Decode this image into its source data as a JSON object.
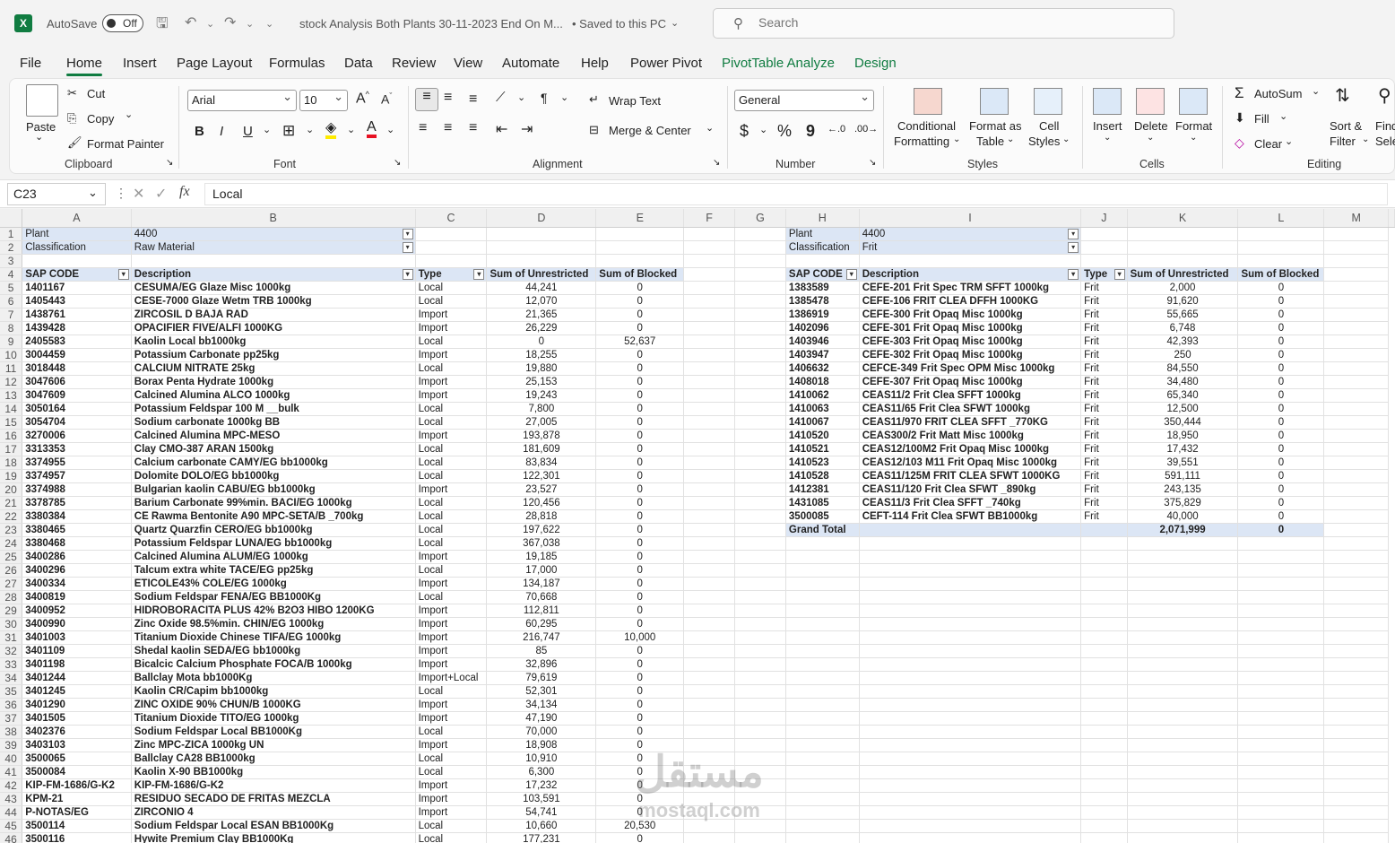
{
  "titlebar": {
    "app_icon": "X",
    "autosave_label": "AutoSave",
    "autosave_state": "Off",
    "doc_title": "stock Analysis  Both Plants 30-11-2023 End On M...",
    "save_status": "• Saved to this PC",
    "save_status_caret": "⌄"
  },
  "search": {
    "placeholder": "Search"
  },
  "tabs": [
    "File",
    "Home",
    "Insert",
    "Page Layout",
    "Formulas",
    "Data",
    "Review",
    "View",
    "Automate",
    "Help",
    "Power Pivot",
    "PivotTable Analyze",
    "Design"
  ],
  "ribbon": {
    "clipboard": {
      "paste": "Paste",
      "cut": "Cut",
      "copy": "Copy",
      "format_painter": "Format Painter",
      "label": "Clipboard"
    },
    "font": {
      "name": "Arial",
      "size": "10",
      "bold": "B",
      "italic": "I",
      "underline": "U",
      "label": "Font"
    },
    "alignment": {
      "wrap": "Wrap Text",
      "merge": "Merge & Center",
      "label": "Alignment"
    },
    "number": {
      "format": "General",
      "currency": "$",
      "percent": "%",
      "comma": "9",
      "label": "Number"
    },
    "styles": {
      "cond1": "Conditional",
      "cond2": "Formatting",
      "fmt1": "Format as",
      "fmt2": "Table",
      "cell1": "Cell",
      "cell2": "Styles",
      "label": "Styles"
    },
    "cells": {
      "insert": "Insert",
      "delete": "Delete",
      "format": "Format",
      "label": "Cells"
    },
    "editing": {
      "autosum": "AutoSum",
      "fill": "Fill",
      "clear": "Clear",
      "sort1": "Sort &",
      "sort2": "Filter",
      "find1": "Find",
      "find2": "Sele",
      "label": "Editing"
    }
  },
  "formula_bar": {
    "name_box": "C23",
    "fx": "fx",
    "value": "Local"
  },
  "columns": [
    "A",
    "B",
    "C",
    "D",
    "E",
    "F",
    "G",
    "H",
    "I",
    "J",
    "K",
    "L",
    "M"
  ],
  "left_pivot": {
    "plant_label": "Plant",
    "plant_value": "4400",
    "class_label": "Classification",
    "class_value": "Raw Material",
    "headers": [
      "SAP CODE",
      "Description",
      "Type",
      "Sum of Unrestricted",
      "Sum of Blocked"
    ],
    "rows": [
      [
        "1401167",
        "CESUMA/EG Glaze Misc 1000kg",
        "Local",
        "44,241",
        "0"
      ],
      [
        "1405443",
        "CESE-7000 Glaze Wetm TRB 1000kg",
        "Local",
        "12,070",
        "0"
      ],
      [
        "1438761",
        "ZIRCOSIL D BAJA RAD",
        "Import",
        "21,365",
        "0"
      ],
      [
        "1439428",
        "OPACIFIER FIVE/ALFI 1000KG",
        "Import",
        "26,229",
        "0"
      ],
      [
        "2405583",
        "Kaolin Local bb1000kg",
        "Local",
        "0",
        "52,637"
      ],
      [
        "3004459",
        "Potassium Carbonate pp25kg",
        "Import",
        "18,255",
        "0"
      ],
      [
        "3018448",
        "CALCIUM NITRATE 25kg",
        "Local",
        "19,880",
        "0"
      ],
      [
        "3047606",
        "Borax Penta Hydrate 1000kg",
        "Import",
        "25,153",
        "0"
      ],
      [
        "3047609",
        "Calcined Alumina ALCO 1000kg",
        "Import",
        "19,243",
        "0"
      ],
      [
        "3050164",
        "Potassium Feldspar 100 M __bulk",
        "Local",
        "7,800",
        "0"
      ],
      [
        "3054704",
        "Sodium carbonate 1000kg BB",
        "Local",
        "27,005",
        "0"
      ],
      [
        "3270006",
        "Calcined Alumina MPC-MESO",
        "Import",
        "193,878",
        "0"
      ],
      [
        "3313353",
        "Clay CMO-387 ARAN 1500kg",
        "Local",
        "181,609",
        "0"
      ],
      [
        "3374955",
        "Calcium carbonate CAMY/EG bb1000kg",
        "Local",
        "83,834",
        "0"
      ],
      [
        "3374957",
        "Dolomite DOLO/EG bb1000kg",
        "Local",
        "122,301",
        "0"
      ],
      [
        "3374988",
        "Bulgarian kaolin CABU/EG bb1000kg",
        "Import",
        "23,527",
        "0"
      ],
      [
        "3378785",
        "Barium Carbonate 99%min. BACI/EG 1000kg",
        "Local",
        "120,456",
        "0"
      ],
      [
        "3380384",
        "CE Rawma Bentonite A90 MPC-SETA/B _700kg",
        "Local",
        "28,818",
        "0"
      ],
      [
        "3380465",
        "Quartz Quarzfin CERO/EG bb1000kg",
        "Local",
        "197,622",
        "0"
      ],
      [
        "3380468",
        "Potassium Feldspar LUNA/EG bb1000kg",
        "Local",
        "367,038",
        "0"
      ],
      [
        "3400286",
        "Calcined Alumina ALUM/EG 1000kg",
        "Import",
        "19,185",
        "0"
      ],
      [
        "3400296",
        "Talcum extra white TACE/EG pp25kg",
        "Local",
        "17,000",
        "0"
      ],
      [
        "3400334",
        "ETICOLE43% COLE/EG 1000kg",
        "Import",
        "134,187",
        "0"
      ],
      [
        "3400819",
        "Sodium Feldspar FENA/EG BB1000Kg",
        "Local",
        "70,668",
        "0"
      ],
      [
        "3400952",
        "HIDROBORACITA PLUS 42% B2O3 HIBO 1200KG",
        "Import",
        "112,811",
        "0"
      ],
      [
        "3400990",
        "Zinc Oxide 98.5%min. CHIN/EG 1000kg",
        "Import",
        "60,295",
        "0"
      ],
      [
        "3401003",
        "Titanium Dioxide Chinese TIFA/EG 1000kg",
        "Import",
        "216,747",
        "10,000"
      ],
      [
        "3401109",
        "Shedal kaolin SEDA/EG bb1000kg",
        "Import",
        "85",
        "0"
      ],
      [
        "3401198",
        "Bicalcic Calcium Phosphate FOCA/B 1000kg",
        "Import",
        "32,896",
        "0"
      ],
      [
        "3401244",
        "Ballclay Mota bb1000Kg",
        "Import+Local",
        "79,619",
        "0"
      ],
      [
        "3401245",
        "Kaolin CR/Capim bb1000kg",
        "Local",
        "52,301",
        "0"
      ],
      [
        "3401290",
        "ZINC OXIDE 90% CHUN/B 1000KG",
        "Import",
        "34,134",
        "0"
      ],
      [
        "3401505",
        "Titanium Dioxide TITO/EG 1000kg",
        "Import",
        "47,190",
        "0"
      ],
      [
        "3402376",
        "Sodium Feldspar Local BB1000Kg",
        "Local",
        "70,000",
        "0"
      ],
      [
        "3403103",
        "Zinc MPC-ZICA 1000kg UN",
        "Import",
        "18,908",
        "0"
      ],
      [
        "3500065",
        "Ballclay CA28 BB1000kg",
        "Local",
        "10,910",
        "0"
      ],
      [
        "3500084",
        "Kaolin X-90 BB1000kg",
        "Local",
        "6,300",
        "0"
      ],
      [
        "KIP-FM-1686/G-K2",
        "KIP-FM-1686/G-K2",
        "Import",
        "17,232",
        "0"
      ],
      [
        "KPM-21",
        "RESIDUO SECADO DE FRITAS MEZCLA",
        "Import",
        "103,591",
        "0"
      ],
      [
        "P-NOTAS/EG",
        "ZIRCONIO 4",
        "Import",
        "54,741",
        "0"
      ],
      [
        "3500114",
        "Sodium Feldspar Local ESAN BB1000Kg",
        "Local",
        "10,660",
        "20,530"
      ],
      [
        "3500116",
        "Hywite Premium Clay BB1000Kg",
        "Local",
        "177,231",
        "0"
      ]
    ]
  },
  "right_pivot": {
    "plant_label": "Plant",
    "plant_value": "4400",
    "class_label": "Classification",
    "class_value": "Frit",
    "headers": [
      "SAP CODE",
      "Description",
      "Type",
      "Sum of Unrestricted",
      "Sum of Blocked"
    ],
    "rows": [
      [
        "1383589",
        "CEFE-201 Frit Spec TRM SFFT 1000kg",
        "Frit",
        "2,000",
        "0"
      ],
      [
        "1385478",
        "CEFE-106 FRIT CLEA DFFH 1000KG",
        "Frit",
        "91,620",
        "0"
      ],
      [
        "1386919",
        "CEFE-300 Frit Opaq Misc 1000kg",
        "Frit",
        "55,665",
        "0"
      ],
      [
        "1402096",
        "CEFE-301 Frit Opaq Misc 1000kg",
        "Frit",
        "6,748",
        "0"
      ],
      [
        "1403946",
        "CEFE-303 Frit Opaq Misc 1000kg",
        "Frit",
        "42,393",
        "0"
      ],
      [
        "1403947",
        "CEFE-302 Frit Opaq Misc 1000kg",
        "Frit",
        "250",
        "0"
      ],
      [
        "1406632",
        "CEFCE-349 Frit Spec OPM Misc 1000kg",
        "Frit",
        "84,550",
        "0"
      ],
      [
        "1408018",
        "CEFE-307 Frit Opaq Misc 1000kg",
        "Frit",
        "34,480",
        "0"
      ],
      [
        "1410062",
        "CEAS11/2 Frit Clea SFFT 1000kg",
        "Frit",
        "65,340",
        "0"
      ],
      [
        "1410063",
        "CEAS11/65 Frit Clea SFWT 1000kg",
        "Frit",
        "12,500",
        "0"
      ],
      [
        "1410067",
        "CEAS11/970 FRIT CLEA SFFT _770KG",
        "Frit",
        "350,444",
        "0"
      ],
      [
        "1410520",
        "CEAS300/2 Frit Matt Misc 1000kg",
        "Frit",
        "18,950",
        "0"
      ],
      [
        "1410521",
        "CEAS12/100M2 Frit Opaq Misc 1000kg",
        "Frit",
        "17,432",
        "0"
      ],
      [
        "1410523",
        "CEAS12/103 M11 Frit Opaq Misc 1000kg",
        "Frit",
        "39,551",
        "0"
      ],
      [
        "1410528",
        "CEAS11/125M FRIT CLEA SFWT 1000KG",
        "Frit",
        "591,111",
        "0"
      ],
      [
        "1412381",
        "CEAS11/120 Frit Clea SFWT _890kg",
        "Frit",
        "243,135",
        "0"
      ],
      [
        "1431085",
        "CEAS11/3 Frit Clea SFFT _740kg",
        "Frit",
        "375,829",
        "0"
      ],
      [
        "3500085",
        "CEFT-114 Frit Clea SFWT BB1000kg",
        "Frit",
        "40,000",
        "0"
      ]
    ],
    "grand_total_label": "Grand Total",
    "grand_total_unrestricted": "2,071,999",
    "grand_total_blocked": "0"
  },
  "watermark": {
    "text": "مستقل",
    "url": "mostaql.com"
  }
}
